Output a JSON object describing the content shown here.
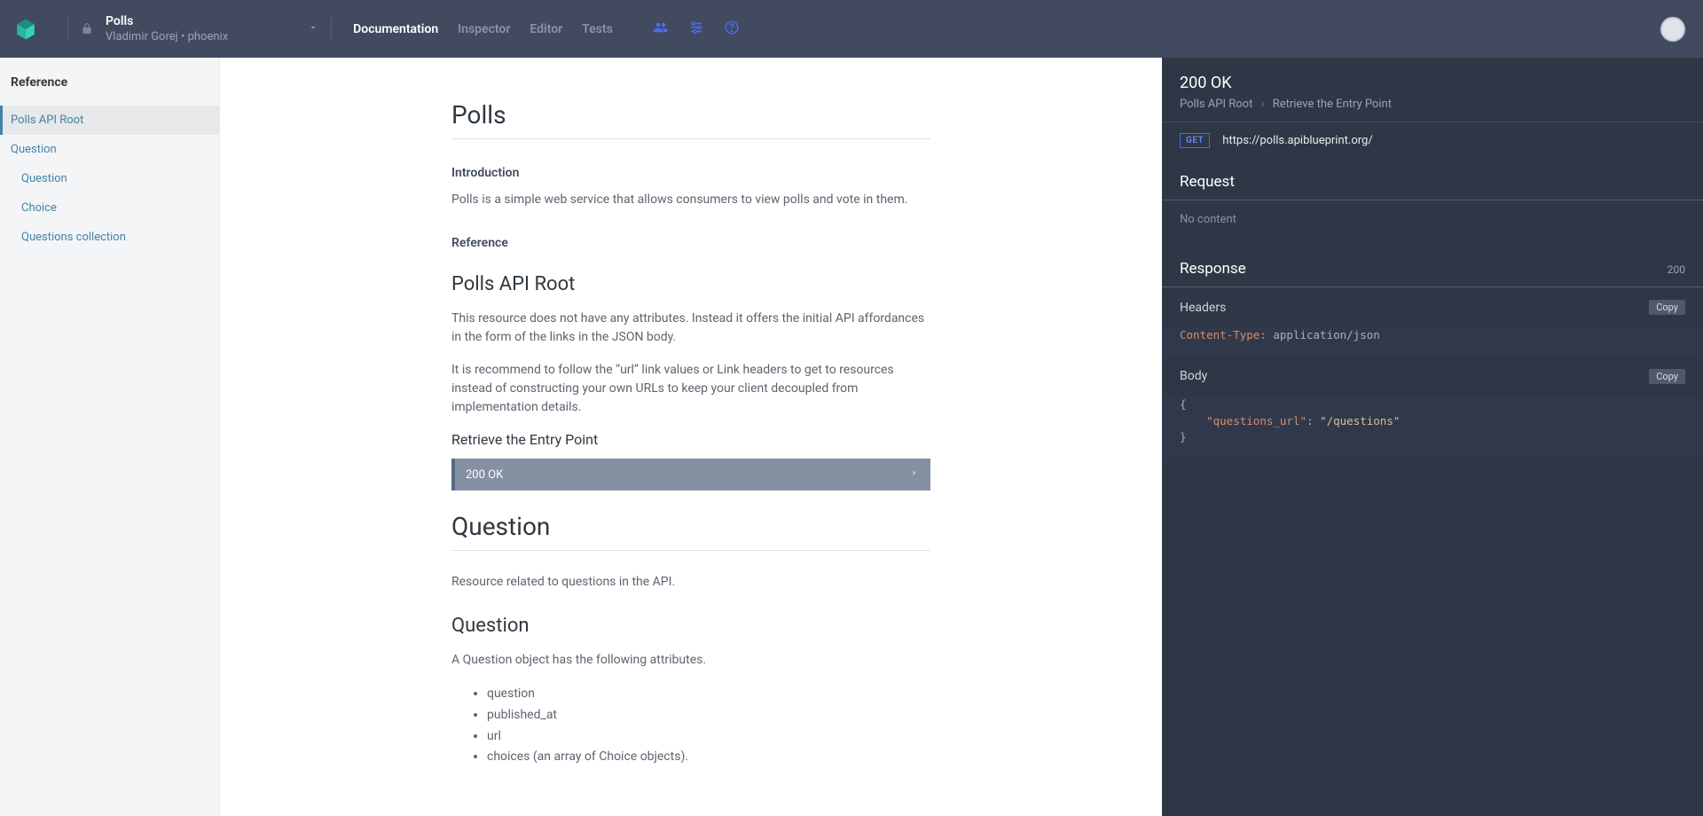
{
  "header": {
    "project_title": "Polls",
    "project_sub": "Vladimir Gorej • phoenix",
    "nav": {
      "documentation": "Documentation",
      "inspector": "Inspector",
      "editor": "Editor",
      "tests": "Tests"
    }
  },
  "sidebar": {
    "heading": "Reference",
    "items": [
      {
        "label": "Polls API Root"
      },
      {
        "label": "Question"
      },
      {
        "label": "Question"
      },
      {
        "label": "Choice"
      },
      {
        "label": "Questions collection"
      }
    ]
  },
  "doc": {
    "title": "Polls",
    "intro_h": "Introduction",
    "intro_p": "Polls is a simple web service that allows consumers to view polls and vote in them.",
    "ref_h": "Reference",
    "root_h": "Polls API Root",
    "root_p1": "This resource does not have any attributes. Instead it offers the initial API affordances in the form of the links in the JSON body.",
    "root_p2": "It is recommend to follow the “url” link values or Link headers to get to resources instead of constructing your own URLs to keep your client decoupled from implementation details.",
    "entry_h": "Retrieve the Entry Point",
    "status_btn": "200 OK",
    "question_h": "Question",
    "question_p": "Resource related to questions in the API.",
    "question_sub_h": "Question",
    "question_attr_p": "A Question object has the following attributes.",
    "attrs": {
      "a0": "question",
      "a1": "published_at",
      "a2": "url",
      "a3": "choices (an array of Choice objects)."
    }
  },
  "right": {
    "status": "200 OK",
    "bc1": "Polls API Root",
    "bc2": "Retrieve the Entry Point",
    "method": "GET",
    "url": "https://polls.apiblueprint.org/",
    "request_h": "Request",
    "no_content": "No content",
    "response_h": "Response",
    "response_code": "200",
    "headers_h": "Headers",
    "copy": "Copy",
    "header_key": "Content-Type:",
    "header_val": "application/json",
    "body_h": "Body",
    "body_key": "\"questions_url\"",
    "body_val": "\"/questions\""
  }
}
